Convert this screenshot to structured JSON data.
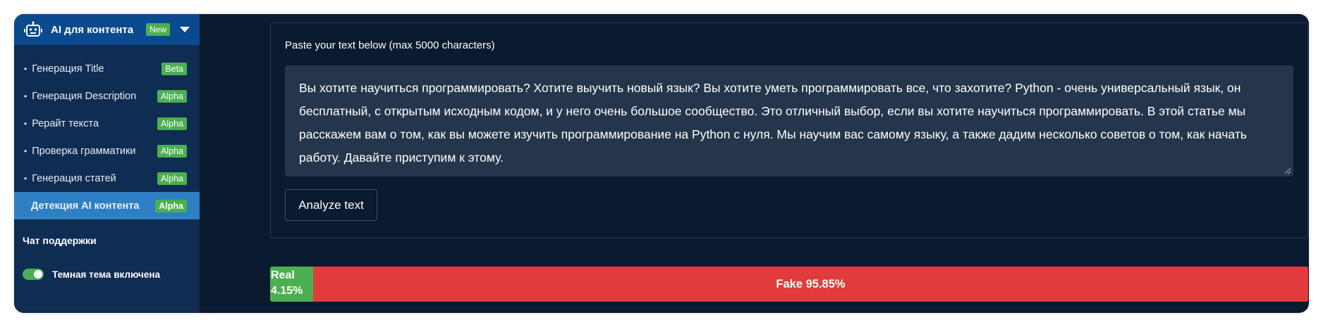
{
  "sidebar": {
    "header": {
      "title": "AI для контента",
      "badge": "New",
      "icon": "robot-icon"
    },
    "items": [
      {
        "label": "Генерация Title",
        "tag": "Beta",
        "active": false
      },
      {
        "label": "Генерация Description",
        "tag": "Alpha",
        "active": false
      },
      {
        "label": "Рерайт текста",
        "tag": "Alpha",
        "active": false
      },
      {
        "label": "Проверка грамматики",
        "tag": "Alpha",
        "active": false
      },
      {
        "label": "Генерация статей",
        "tag": "Alpha",
        "active": false
      },
      {
        "label": "Детекция AI контента",
        "tag": "Alpha",
        "active": true
      }
    ],
    "support_chat": "Чат поддержки",
    "dark_theme": {
      "label": "Темная тема включена",
      "enabled": true
    }
  },
  "main": {
    "input_label": "Paste your text below (max 5000 characters)",
    "text_value": "Вы хотите научиться программировать? Хотите выучить новый язык? Вы хотите уметь программировать все, что захотите? Python - очень универсальный язык, он бесплатный, с открытым исходным кодом, и у него очень большое сообщество. Это отличный выбор, если вы хотите научиться программировать. В этой статье мы расскажем вам о том, как вы можете изучить программирование на Python с нуля. Мы научим вас самому языку, а также дадим несколько советов о том, как начать работу. Давайте приступим к этому.",
    "analyze_button": "Analyze text"
  },
  "result": {
    "real_label": "Real",
    "real_percent": "4.15%",
    "real_value": 4.15,
    "fake_text": "Fake 95.85%",
    "fake_value": 95.85
  },
  "colors": {
    "real": "#4caf50",
    "fake": "#e03c3c",
    "active_item": "#2f7fc4",
    "sidebar_bg": "#0f2c52",
    "page_bg": "#0a1a2f"
  }
}
